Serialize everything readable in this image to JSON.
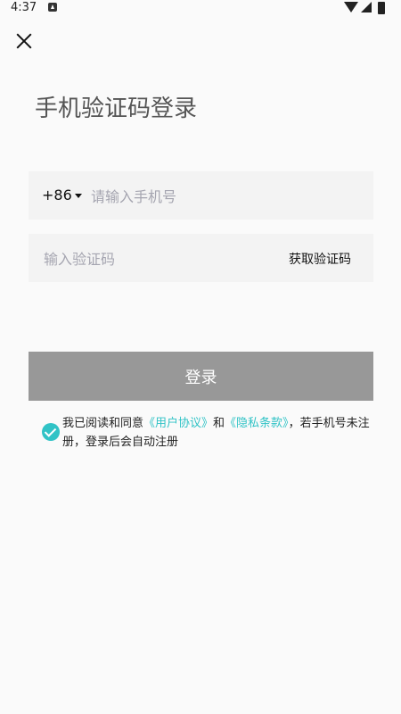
{
  "status_bar": {
    "time": "4:37"
  },
  "title": "手机验证码登录",
  "phone": {
    "country_code": "+86",
    "placeholder": "请输入手机号",
    "value": ""
  },
  "code": {
    "placeholder": "输入验证码",
    "value": "",
    "get_code_label": "获取验证码"
  },
  "login_button": "登录",
  "agreement": {
    "checked": true,
    "prefix": "我已阅读和同意",
    "user_agreement": "《用户协议》",
    "and": "和",
    "privacy_policy": "《隐私条款》",
    "suffix": "，若手机号未注册，登录后会自动注册"
  },
  "colors": {
    "accent": "#31c3c6",
    "button_disabled": "#989898",
    "background": "#fafafa",
    "field_background": "#f3f3f3"
  },
  "icons": {
    "close": "close-icon",
    "check": "check-circle-icon",
    "dropdown": "caret-down-icon"
  }
}
